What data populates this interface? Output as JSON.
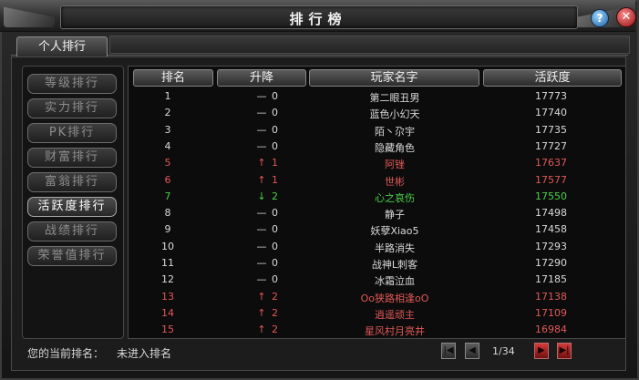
{
  "window": {
    "title": "排行榜",
    "help_label": "?",
    "close_label": "✕"
  },
  "tabs": [
    {
      "label": "个人排行"
    }
  ],
  "sidebar": {
    "items": [
      {
        "label": "等级排行",
        "active": false
      },
      {
        "label": "实力排行",
        "active": false
      },
      {
        "label": "PK排行",
        "active": false
      },
      {
        "label": "财富排行",
        "active": false
      },
      {
        "label": "富翁排行",
        "active": false
      },
      {
        "label": "活跃度排行",
        "active": true
      },
      {
        "label": "战绩排行",
        "active": false
      },
      {
        "label": "荣誉值排行",
        "active": false
      }
    ]
  },
  "table": {
    "headers": [
      "排名",
      "升降",
      "玩家名字",
      "活跃度"
    ],
    "rows": [
      {
        "rank": "1",
        "arrow": "—",
        "change": "0",
        "name": "第二眼丑男",
        "activity": "17773",
        "trend": "normal"
      },
      {
        "rank": "2",
        "arrow": "—",
        "change": "0",
        "name": "蓝色小幻天",
        "activity": "17740",
        "trend": "normal"
      },
      {
        "rank": "3",
        "arrow": "—",
        "change": "0",
        "name": "陌丶尕宇",
        "activity": "17735",
        "trend": "normal"
      },
      {
        "rank": "4",
        "arrow": "—",
        "change": "0",
        "name": "隐藏角色",
        "activity": "17727",
        "trend": "normal"
      },
      {
        "rank": "5",
        "arrow": "↑",
        "change": "1",
        "name": "阿锉",
        "activity": "17637",
        "trend": "up"
      },
      {
        "rank": "6",
        "arrow": "↑",
        "change": "1",
        "name": "世彬",
        "activity": "17577",
        "trend": "up"
      },
      {
        "rank": "7",
        "arrow": "↓",
        "change": "2",
        "name": "心之哀伤",
        "activity": "17550",
        "trend": "down"
      },
      {
        "rank": "8",
        "arrow": "—",
        "change": "0",
        "name": "静子",
        "activity": "17498",
        "trend": "normal"
      },
      {
        "rank": "9",
        "arrow": "—",
        "change": "0",
        "name": "妖孽Xiao5",
        "activity": "17458",
        "trend": "normal"
      },
      {
        "rank": "10",
        "arrow": "—",
        "change": "0",
        "name": "半路消失",
        "activity": "17293",
        "trend": "normal"
      },
      {
        "rank": "11",
        "arrow": "—",
        "change": "0",
        "name": "战神L刺客",
        "activity": "17290",
        "trend": "normal"
      },
      {
        "rank": "12",
        "arrow": "—",
        "change": "0",
        "name": "冰霜泣血",
        "activity": "17185",
        "trend": "normal"
      },
      {
        "rank": "13",
        "arrow": "↑",
        "change": "2",
        "name": "Oo狭路相逢oO",
        "activity": "17138",
        "trend": "up"
      },
      {
        "rank": "14",
        "arrow": "↑",
        "change": "2",
        "name": "逍遥顽主",
        "activity": "17109",
        "trend": "up"
      },
      {
        "rank": "15",
        "arrow": "↑",
        "change": "2",
        "name": "星风村月亮井",
        "activity": "16984",
        "trend": "up"
      }
    ]
  },
  "footer": {
    "my_rank_label": "您的当前排名：",
    "my_rank_value": "未进入排名",
    "page": "1/34",
    "first_icon": "first-page-icon",
    "prev_icon": "prev-page-icon",
    "next_icon": "next-page-icon",
    "last_icon": "last-page-icon"
  },
  "colors": {
    "normal": "#d9d9d9",
    "up": "#e05858",
    "down": "#4ad14a",
    "next_button": "#d43b3b"
  }
}
